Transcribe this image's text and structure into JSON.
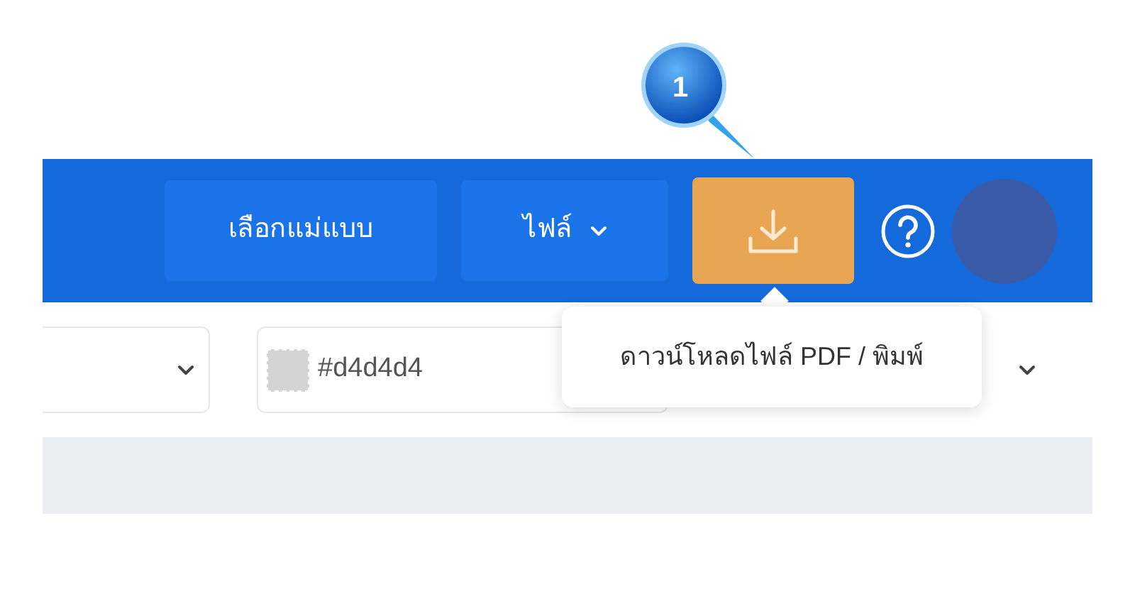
{
  "header": {
    "buttons": [
      {
        "kind": "text",
        "label": "เลือกแม่แบบ"
      },
      {
        "kind": "menu",
        "label": "ไฟล์"
      },
      {
        "kind": "download"
      }
    ]
  },
  "toolbar": {
    "color_field": {
      "value": "#d4d4d4"
    }
  },
  "tooltip": {
    "text": "ดาวน์โหลดไฟล์ PDF / พิมพ์"
  },
  "callout": {
    "number": "1"
  }
}
